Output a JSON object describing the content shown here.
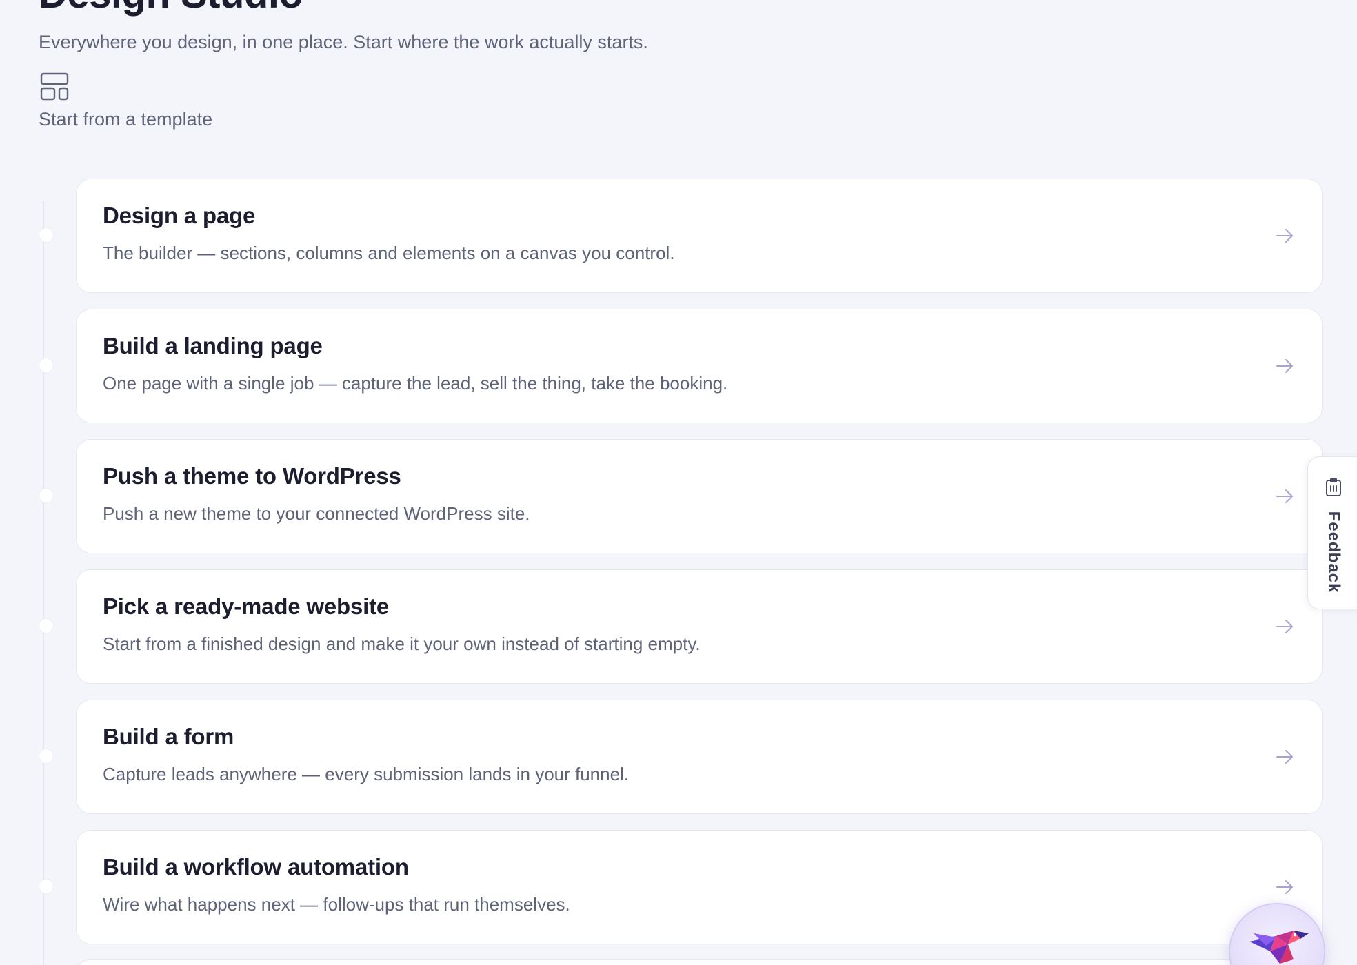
{
  "header": {
    "title": "Design Studio",
    "subtitle": "Everywhere you design, in one place. Start where the work actually starts.",
    "template_icon": "layout-template-icon",
    "template_label": "Start from a template"
  },
  "cards": [
    {
      "title": "Design a page",
      "description": "The builder — sections, columns and elements on a canvas you control."
    },
    {
      "title": "Build a landing page",
      "description": "One page with a single job — capture the lead, sell the thing, take the booking."
    },
    {
      "title": "Push a theme to WordPress",
      "description": "Push a new theme to your connected WordPress site."
    },
    {
      "title": "Pick a ready-made website",
      "description": "Start from a finished design and make it your own instead of starting empty."
    },
    {
      "title": "Build a form",
      "description": "Capture leads anywhere — every submission lands in your funnel."
    },
    {
      "title": "Build a workflow automation",
      "description": "Wire what happens next — follow-ups that run themselves."
    }
  ],
  "feedback": {
    "label": "Feedback",
    "icon": "feedback-clipboard-icon"
  },
  "chat": {
    "icon": "hummingbird-icon"
  },
  "colors": {
    "background": "#f4f5fa",
    "card": "#ffffff",
    "title_text": "#1c1d2e",
    "muted_text": "#5f6378",
    "arrow": "#a9a4cf"
  }
}
